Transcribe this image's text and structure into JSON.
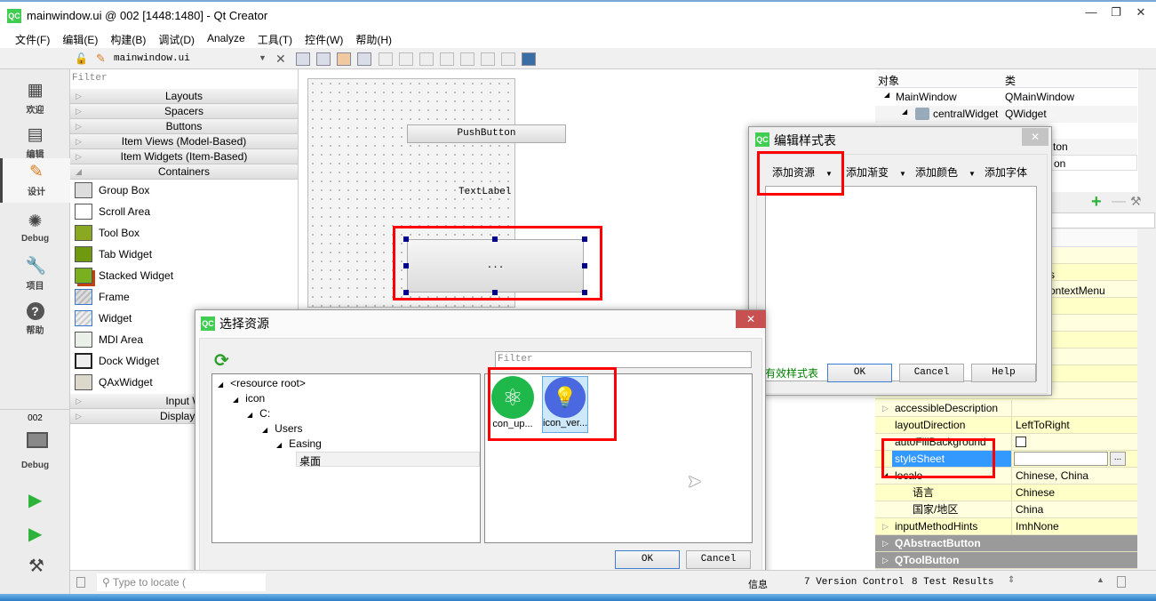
{
  "window": {
    "title": "mainwindow.ui @ 002 [1448:1480] - Qt Creator",
    "app_icon": "QC"
  },
  "menu": [
    "文件(F)",
    "编辑(E)",
    "构建(B)",
    "调试(D)",
    "Analyze",
    "工具(T)",
    "控件(W)",
    "帮助(H)"
  ],
  "toolbar": {
    "file": "mainwindow.ui"
  },
  "modes": [
    {
      "label": "欢迎",
      "icon": "grid-icon"
    },
    {
      "label": "编辑",
      "icon": "document-icon"
    },
    {
      "label": "设计",
      "icon": "pencil-icon"
    },
    {
      "label": "Debug",
      "icon": "bug-icon"
    },
    {
      "label": "项目",
      "icon": "wrench-icon"
    },
    {
      "label": "帮助",
      "icon": "help-icon"
    }
  ],
  "kit": {
    "project": "002",
    "mode": "Debug"
  },
  "widgetbox": {
    "filter_placeholder": "Filter",
    "categories_top": [
      "Layouts",
      "Spacers",
      "Buttons",
      "Item Views (Model-Based)",
      "Item Widgets (Item-Based)",
      "Containers"
    ],
    "containers": [
      "Group Box",
      "Scroll Area",
      "Tool Box",
      "Tab Widget",
      "Stacked Widget",
      "Frame",
      "Widget",
      "MDI Area",
      "Dock Widget",
      "QAxWidget"
    ],
    "categories_bottom": [
      "Input W",
      "Display W"
    ]
  },
  "form": {
    "push_button": "PushButton",
    "text_label": "TextLabel",
    "tool_button": "..."
  },
  "object_inspector": {
    "headers": [
      "对象",
      "类"
    ],
    "rows": [
      {
        "name": "MainWindow",
        "class": "QMainWindow"
      },
      {
        "name": "centralWidget",
        "class": "QWidget"
      },
      {
        "name": "",
        "class": "ton"
      },
      {
        "name": "",
        "class": "on"
      }
    ]
  },
  "properties": {
    "partial": [
      "s",
      "ontextMenu"
    ],
    "rows": [
      {
        "name": "accessibleDescription",
        "value": ""
      },
      {
        "name": "layoutDirection",
        "value": "LeftToRight"
      },
      {
        "name": "autoFillBackground",
        "value": ""
      },
      {
        "name": "styleSheet",
        "value": ""
      },
      {
        "name": "locale",
        "value": "Chinese, China"
      },
      {
        "name": "语言",
        "value": "Chinese"
      },
      {
        "name": "国家/地区",
        "value": "China"
      },
      {
        "name": "inputMethodHints",
        "value": "ImhNone"
      }
    ],
    "groups": [
      "QAbstractButton",
      "QToolButton"
    ],
    "more_button": "..."
  },
  "style_dialog": {
    "title": "编辑样式表",
    "tools": [
      "添加资源",
      "添加渐变",
      "添加颜色",
      "添加字体"
    ],
    "status": "有效样式表",
    "ok": "OK",
    "cancel": "Cancel",
    "help": "Help"
  },
  "resource_dialog": {
    "title": "选择资源",
    "filter_placeholder": "Filter",
    "tree": [
      "<resource root>",
      "icon",
      "C:",
      "Users",
      "Easing",
      "桌面"
    ],
    "files": [
      {
        "label": "con_up...",
        "color": "#1db954"
      },
      {
        "label": "icon_ver...",
        "color": "#4169e1"
      }
    ],
    "ok": "OK",
    "cancel": "Cancel"
  },
  "statusbar": {
    "locate_placeholder": "Type to locate (",
    "panes": [
      "信息",
      "7 Version Control",
      "8 Test Results"
    ]
  }
}
